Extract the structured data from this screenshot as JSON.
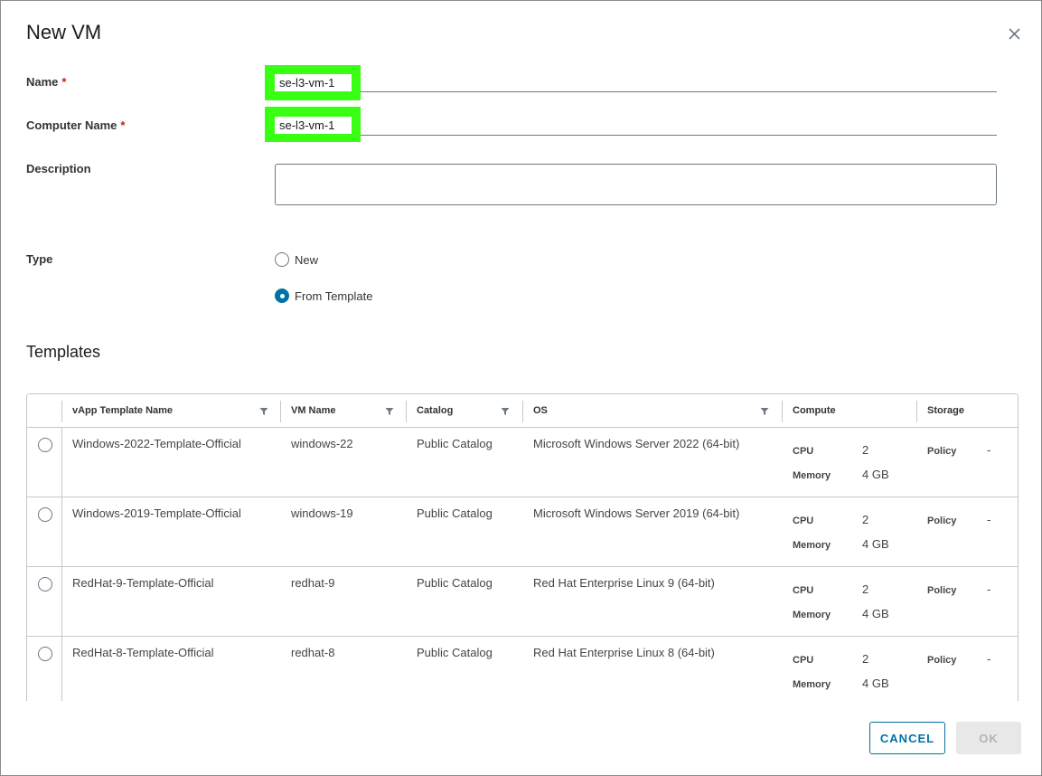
{
  "dialog": {
    "title": "New VM"
  },
  "form": {
    "name": {
      "label": "Name",
      "required_mark": "*",
      "value": "se-l3-vm-1"
    },
    "computer_name": {
      "label": "Computer Name",
      "required_mark": "*",
      "value": "se-l3-vm-1"
    },
    "description": {
      "label": "Description",
      "value": ""
    },
    "type": {
      "label": "Type",
      "options": [
        {
          "label": "New",
          "checked": false
        },
        {
          "label": "From Template",
          "checked": true
        }
      ]
    }
  },
  "templates": {
    "title": "Templates",
    "columns": [
      "vApp Template Name",
      "VM Name",
      "Catalog",
      "OS",
      "Compute",
      "Storage"
    ],
    "compute_labels": {
      "cpu": "CPU",
      "memory": "Memory"
    },
    "storage_label": "Policy",
    "rows": [
      {
        "template": "Windows-2022-Template-Official",
        "vm": "windows-22",
        "catalog": "Public Catalog",
        "os": "Microsoft Windows Server 2022 (64-bit)",
        "cpu": "2",
        "memory": "4 GB",
        "policy": "-"
      },
      {
        "template": "Windows-2019-Template-Official",
        "vm": "windows-19",
        "catalog": "Public Catalog",
        "os": "Microsoft Windows Server 2019 (64-bit)",
        "cpu": "2",
        "memory": "4 GB",
        "policy": "-"
      },
      {
        "template": "RedHat-9-Template-Official",
        "vm": "redhat-9",
        "catalog": "Public Catalog",
        "os": "Red Hat Enterprise Linux 9 (64-bit)",
        "cpu": "2",
        "memory": "4 GB",
        "policy": "-"
      },
      {
        "template": "RedHat-8-Template-Official",
        "vm": "redhat-8",
        "catalog": "Public Catalog",
        "os": "Red Hat Enterprise Linux 8 (64-bit)",
        "cpu": "2",
        "memory": "4 GB",
        "policy": "-"
      }
    ]
  },
  "footer": {
    "cancel_label": "CANCEL",
    "ok_label": "OK"
  },
  "colors": {
    "highlight": "#39ff14",
    "primary": "#0072a3",
    "required": "#c92100"
  }
}
